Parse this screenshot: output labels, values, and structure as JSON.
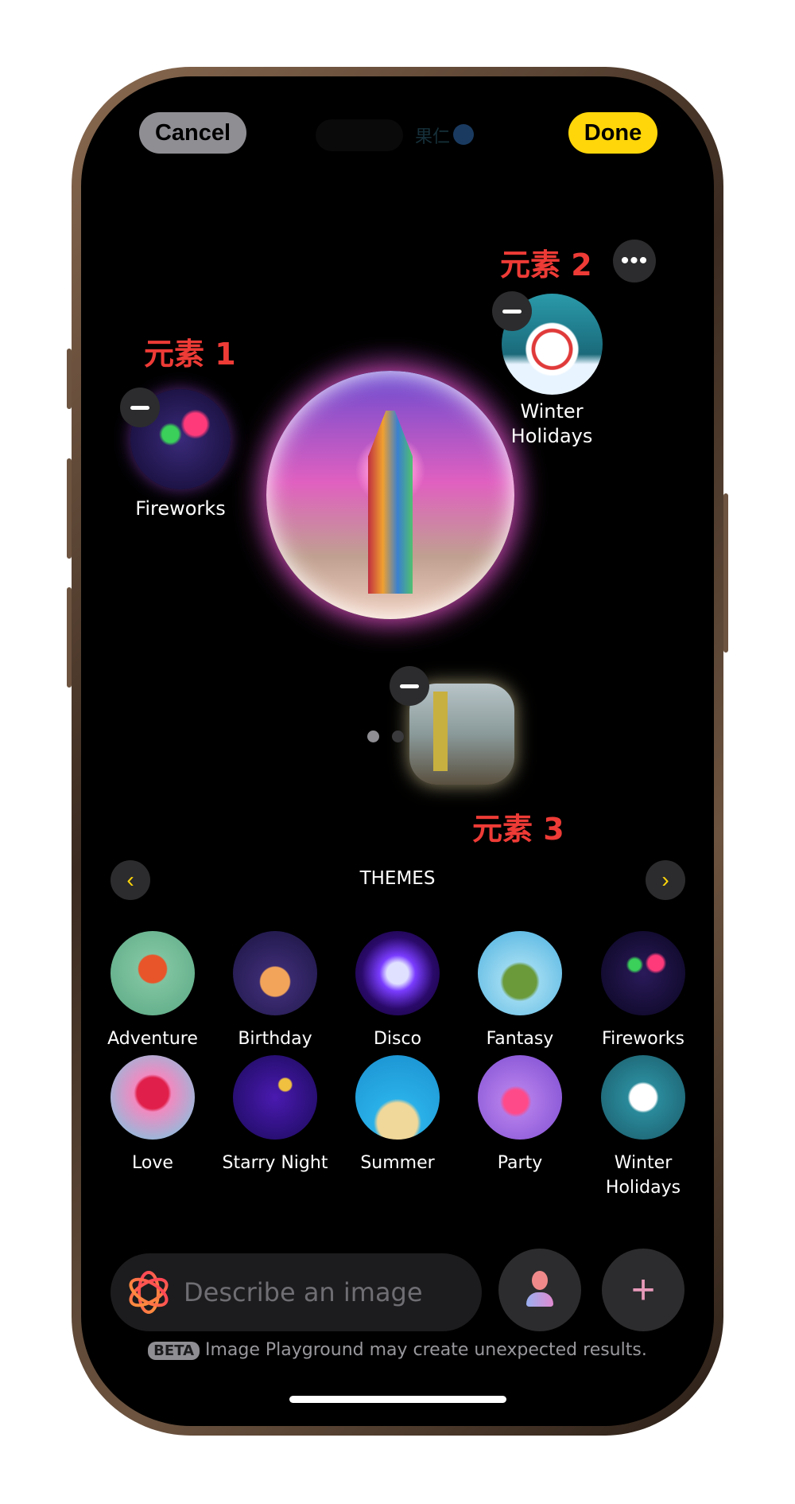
{
  "header": {
    "cancel": "Cancel",
    "done": "Done",
    "island_text": "果仁"
  },
  "annotations": {
    "el1": "元素 1",
    "el2": "元素 2",
    "el3": "元素 3"
  },
  "elements": [
    {
      "label": "Fireworks"
    },
    {
      "label": "Winter Holidays"
    }
  ],
  "pager": {
    "pages": 2,
    "current": 1
  },
  "themes": {
    "title": "THEMES",
    "items": [
      {
        "label": "Adventure",
        "bg": "radial-gradient(circle at 50% 45%,#e8552a 0 22%,#7fc3a0 24%,#5aa884)"
      },
      {
        "label": "Birthday",
        "bg": "radial-gradient(circle at 50% 60%,#f2a45a 0 22%,#3a2a70 24%,#1a1440)"
      },
      {
        "label": "Disco",
        "bg": "radial-gradient(circle,#e0e0ff 0 18%,#7a3cff 30%,#2a0a6a 60%,#100030)"
      },
      {
        "label": "Fantasy",
        "bg": "radial-gradient(circle at 50% 60%,#6a9a3a 0 25%,#9ad8f0 30%,#4ab0e0)"
      },
      {
        "label": "Fireworks",
        "bg": "radial-gradient(circle at 40% 40%,#3ad05a 0 8%,transparent 12%),radial-gradient(circle at 65% 38%,#ff3a7a 0 10%,transparent 14%),radial-gradient(circle,#2a1a5a,#0a0620)"
      },
      {
        "label": "Love",
        "bg": "radial-gradient(circle at 50% 45%,#e0204a 0 25%,#f08ac0 30%,#6ad0e8)"
      },
      {
        "label": "Starry Night",
        "bg": "radial-gradient(circle at 62% 35%,#f0c040 0 8%,transparent 10%),radial-gradient(circle,#4a1ab0,#1a0a5a)"
      },
      {
        "label": "Summer",
        "bg": "radial-gradient(circle at 50% 80%,#f0d89a 0 25%,#2ab0e8 30%,#1a90d0)"
      },
      {
        "label": "Party",
        "bg": "radial-gradient(circle at 45% 55%,#ff4a8a 0 18%,#b07ae8 24%,#7a4ad0)"
      },
      {
        "label": "Winter Holidays",
        "bg": "radial-gradient(circle at 50% 50%,#ffffff 0 22%,#2a8a9a 26%,#1a5a6a)"
      }
    ]
  },
  "input": {
    "placeholder": "Describe an image"
  },
  "footer": {
    "badge": "BETA",
    "disclaimer": "Image Playground may create unexpected results."
  },
  "colors": {
    "done": "#ffd60a",
    "cancel": "#8e8e93",
    "annotation": "#ee3b36",
    "accent_arrow": "#ffd60a"
  }
}
